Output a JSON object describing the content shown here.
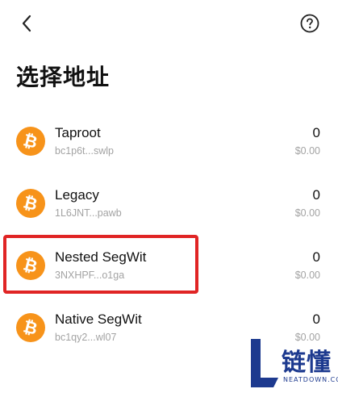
{
  "header": {
    "back_icon": "chevron-left-icon",
    "help_icon": "question-circle-icon"
  },
  "page_title": "选择地址",
  "coin_icon": {
    "name": "bitcoin-icon",
    "color": "#f7931a",
    "glyph": "₿"
  },
  "addresses": [
    {
      "type": "Taproot",
      "address": "bc1p6t...swlp",
      "amount": "0",
      "fiat": "$0.00"
    },
    {
      "type": "Legacy",
      "address": "1L6JNT...pawb",
      "amount": "0",
      "fiat": "$0.00"
    },
    {
      "type": "Nested SegWit",
      "address": "3NXHPF...o1ga",
      "amount": "0",
      "fiat": "$0.00",
      "highlighted": true
    },
    {
      "type": "Native SegWit",
      "address": "bc1qy2...wl07",
      "amount": "0",
      "fiat": "$0.00"
    }
  ],
  "highlight_color": "#e02424",
  "watermark": {
    "name": "链懂",
    "sub": "NEATDOWN.COM",
    "color": "#1d3a8f"
  }
}
